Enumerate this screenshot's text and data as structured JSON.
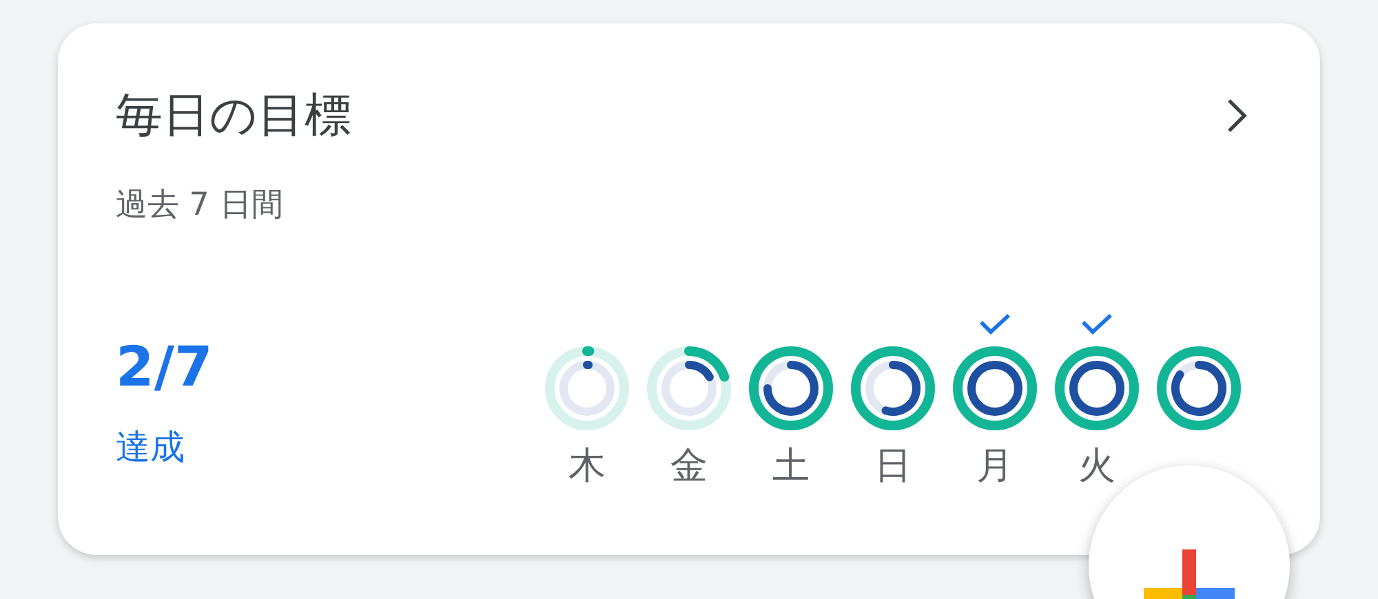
{
  "card": {
    "title": "毎日の目標",
    "subtitle": "過去 7 日間",
    "summary": {
      "value": "2/7",
      "label": "達成"
    },
    "days": [
      {
        "label": "木",
        "achieved": false
      },
      {
        "label": "金",
        "achieved": false
      },
      {
        "label": "土",
        "achieved": false
      },
      {
        "label": "日",
        "achieved": false
      },
      {
        "label": "月",
        "achieved": true
      },
      {
        "label": "火",
        "achieved": true
      },
      {
        "achieved": false
      }
    ]
  }
}
